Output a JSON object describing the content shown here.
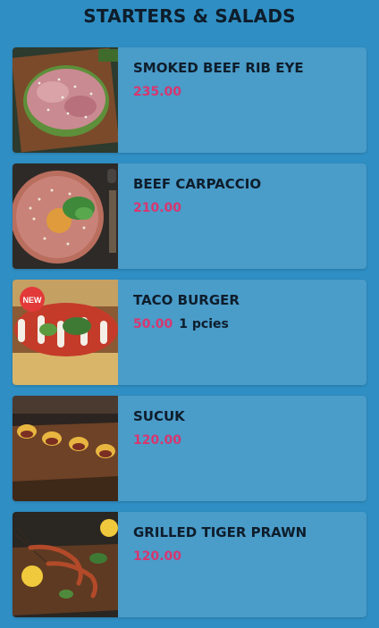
{
  "header": {
    "title": "STARTERS & SALADS"
  },
  "items": [
    {
      "name": "SMOKED BEEF RIB EYE",
      "price": "235.00",
      "note": "",
      "image_icon": "smoked-beef-rib-eye-photo"
    },
    {
      "name": "BEEF CARPACCIO",
      "price": "210.00",
      "note": "",
      "image_icon": "beef-carpaccio-photo"
    },
    {
      "name": "TACO BURGER",
      "price": "50.00",
      "note": "1 pcies",
      "badge": "NEW",
      "image_icon": "taco-burger-photo"
    },
    {
      "name": "SUCUK",
      "price": "120.00",
      "note": "",
      "image_icon": "sucuk-photo"
    },
    {
      "name": "GRILLED TIGER PRAWN",
      "price": "120.00",
      "note": "",
      "image_icon": "grilled-tiger-prawn-photo"
    }
  ],
  "colors": {
    "background": "#2f8fc4",
    "card": "#4a9cc9",
    "title": "#0e1d2b",
    "price": "#d8366f"
  }
}
